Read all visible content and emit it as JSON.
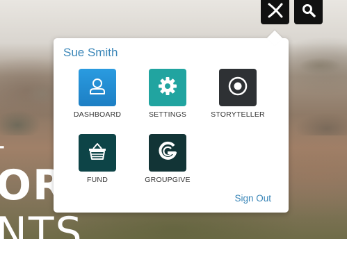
{
  "header": {
    "logo_icon": "close-x-logo-icon",
    "search_icon": "search-icon"
  },
  "hero": {
    "line1": "–",
    "line2": "OR",
    "line3": "NTS"
  },
  "menu": {
    "user_name": "Sue Smith",
    "apps": [
      {
        "label": "DASHBOARD",
        "icon": "person-icon",
        "color": "#2a9be0"
      },
      {
        "label": "SETTINGS",
        "icon": "gear-icon",
        "color": "#21a4a0"
      },
      {
        "label": "STORYTELLER",
        "icon": "target-icon",
        "color": "#2e3134"
      },
      {
        "label": "FUND",
        "icon": "basket-icon",
        "color": "#0d4447"
      },
      {
        "label": "GROUPGIVE",
        "icon": "groupgive-logo-icon",
        "color": "#123436"
      }
    ],
    "sign_out_label": "Sign Out"
  }
}
